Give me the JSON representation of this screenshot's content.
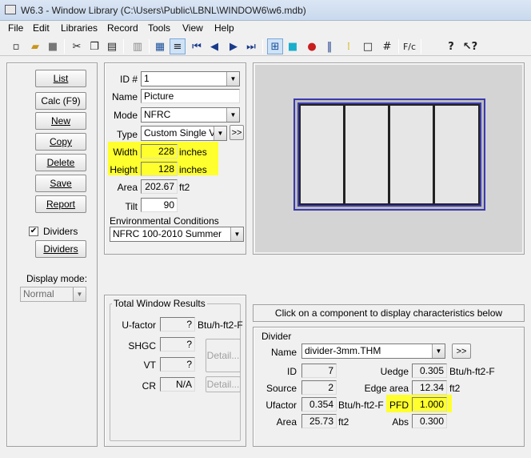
{
  "window": {
    "title": "W6.3 - Window Library (C:\\Users\\Public\\LBNL\\WINDOW6\\w6.mdb)"
  },
  "menu": [
    "File",
    "Edit",
    "Libraries",
    "Record",
    "Tools",
    "View",
    "Help"
  ],
  "toolbar_icons": [
    "new-file-icon",
    "open-folder-icon",
    "save-disk-icon",
    "cut-icon",
    "copy-icon",
    "paste-icon",
    "print-icon",
    "list-view-icon",
    "detail-view-icon",
    "first-record-icon",
    "previous-record-icon",
    "next-record-icon",
    "last-record-icon",
    "grid-icon",
    "fill-icon",
    "locate-icon",
    "pause-icon",
    "highlight-icon",
    "frame-icon",
    "hash-icon",
    "calculate-icon",
    "help-icon",
    "whats-this-icon"
  ],
  "left": {
    "buttons": [
      "List",
      "Calc (F9)",
      "New",
      "Copy",
      "Delete",
      "Save",
      "Report"
    ],
    "dividers_check_label": "Dividers",
    "dividers_checked": true,
    "dividers_button": "Dividers",
    "display_mode_label": "Display mode:",
    "display_mode_value": "Normal"
  },
  "props": {
    "id_label": "ID #",
    "id_value": "1",
    "name_label": "Name",
    "name_value": "Picture",
    "mode_label": "Mode",
    "mode_value": "NFRC",
    "type_label": "Type",
    "type_value": "Custom Single Visi",
    "type_more": ">>",
    "width_label": "Width",
    "width_value": "228",
    "width_unit": "inches",
    "height_label": "Height",
    "height_value": "128",
    "height_unit": "inches",
    "area_label": "Area",
    "area_value": "202.67",
    "area_unit": "ft2",
    "tilt_label": "Tilt",
    "tilt_value": "90",
    "env_label": "Environmental Conditions",
    "env_value": "NFRC 100-2010 Summer"
  },
  "results": {
    "title": "Total Window Results",
    "ufactor_label": "U-factor",
    "ufactor_value": "?",
    "ufactor_unit": "Btu/h-ft2-F",
    "shgc_label": "SHGC",
    "shgc_value": "?",
    "vt_label": "VT",
    "vt_value": "?",
    "cr_label": "CR",
    "cr_value": "N/A",
    "detail1": "Detail...",
    "detail2": "Detail..."
  },
  "info": {
    "hint": "Click on a component to display characteristics below"
  },
  "divider": {
    "title": "Divider",
    "name_label": "Name",
    "name_value": "divider-3mm.THM",
    "name_more": ">>",
    "id_label": "ID",
    "id_value": "7",
    "source_label": "Source",
    "source_value": "2",
    "ufactor_label": "Ufactor",
    "ufactor_value": "0.354",
    "ufactor_unit": "Btu/h-ft2-F",
    "area_label": "Area",
    "area_value": "25.73",
    "area_unit": "ft2",
    "uedge_label": "Uedge",
    "uedge_value": "0.305",
    "uedge_unit": "Btu/h-ft2-F",
    "edge_area_label": "Edge area",
    "edge_area_value": "12.34",
    "edge_area_unit": "ft2",
    "pfd_label": "PFD",
    "pfd_value": "1.000",
    "abs_label": "Abs",
    "abs_value": "0.300"
  },
  "colors": {
    "highlight": "#ffff2e",
    "preview_bg": "#d4d4d4",
    "frame": "#3a3ab0"
  }
}
